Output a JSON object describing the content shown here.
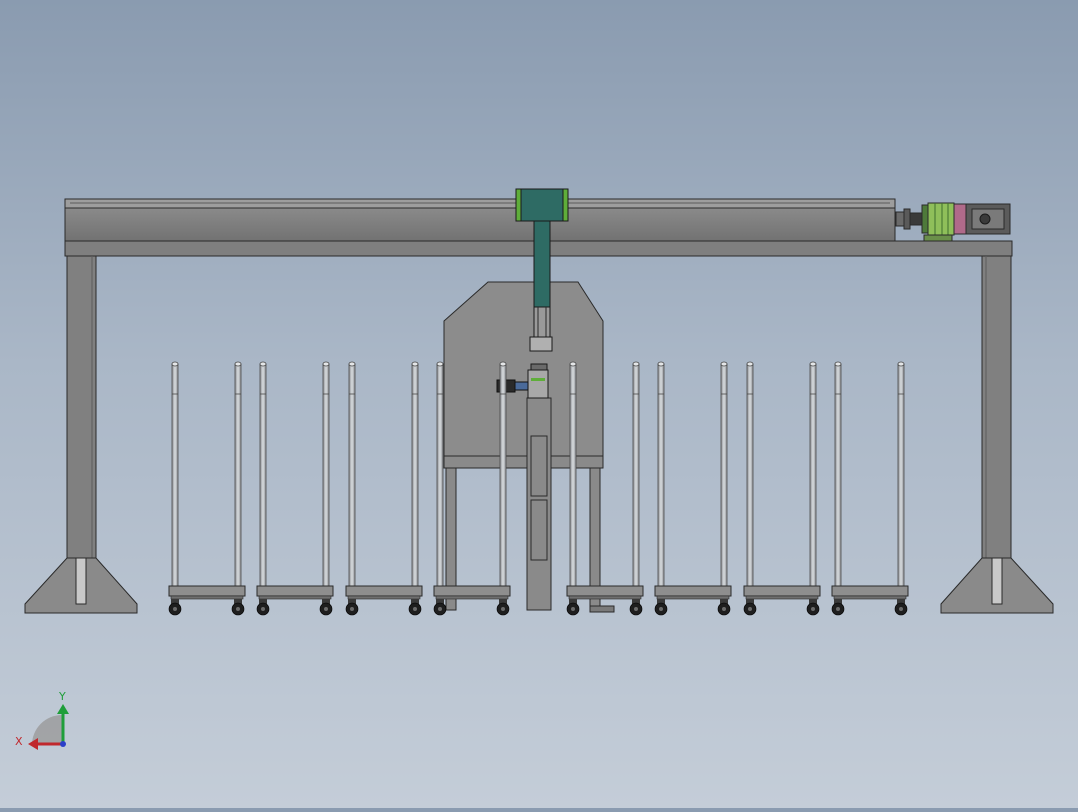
{
  "scene": {
    "view": "front",
    "colors": {
      "frame": "#7d7d7d",
      "frame_light": "#9a9a9a",
      "outline": "#2a2a2a",
      "carriage": "#2e6b64",
      "carriage_accent": "#5fae3a",
      "motor_green": "#8fbf5a",
      "motor_pink": "#b06a8a",
      "motor_dark": "#4a4a4a",
      "pole": "#b5b8bc",
      "cart": "#8a8a8a",
      "wheel": "#1e1e1e"
    },
    "cart_count": 8,
    "pole_count": 16
  },
  "triad": {
    "x_label": "X",
    "y_label": "Y",
    "x_color": "#c0282d",
    "y_color": "#1f9e3a",
    "z_color": "#2a3fc9"
  }
}
